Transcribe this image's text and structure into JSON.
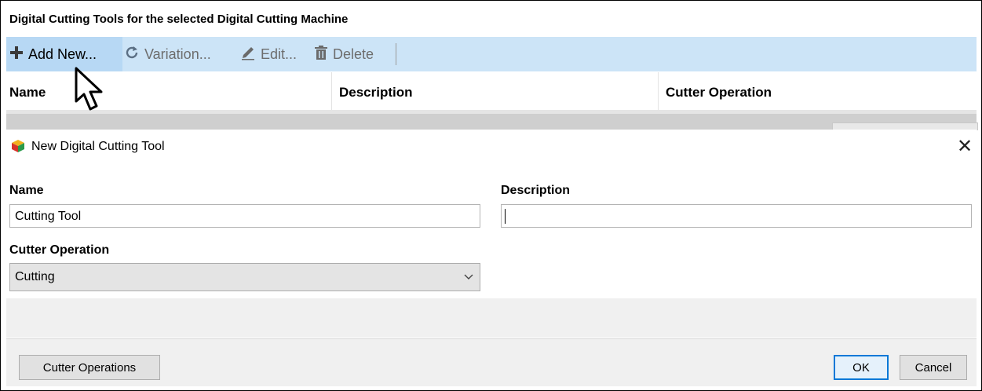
{
  "panel": {
    "title": "Digital Cutting Tools for the selected Digital Cutting Machine",
    "toolbar": {
      "add_new": "Add New...",
      "variation": "Variation...",
      "edit": "Edit...",
      "delete": "Delete"
    },
    "columns": [
      "Name",
      "Description",
      "Cutter Operation"
    ]
  },
  "dialog": {
    "title": "New Digital Cutting Tool",
    "name_label": "Name",
    "name_value": "Cutting Tool",
    "description_label": "Description",
    "description_value": "",
    "cutter_operation_label": "Cutter Operation",
    "cutter_operation_value": "Cutting",
    "cutter_operations_button": "Cutter Operations",
    "ok_button": "OK",
    "cancel_button": "Cancel"
  },
  "icons": {
    "add": "plus-icon",
    "variation": "refresh-icon",
    "edit": "pencil-icon",
    "delete": "trash-icon",
    "dialog": "cube-app-icon",
    "close": "close-icon"
  },
  "colors": {
    "toolbar_bg": "#cce4f7",
    "hover_bg": "#b7d8f4",
    "default_button_border": "#0078d7"
  }
}
